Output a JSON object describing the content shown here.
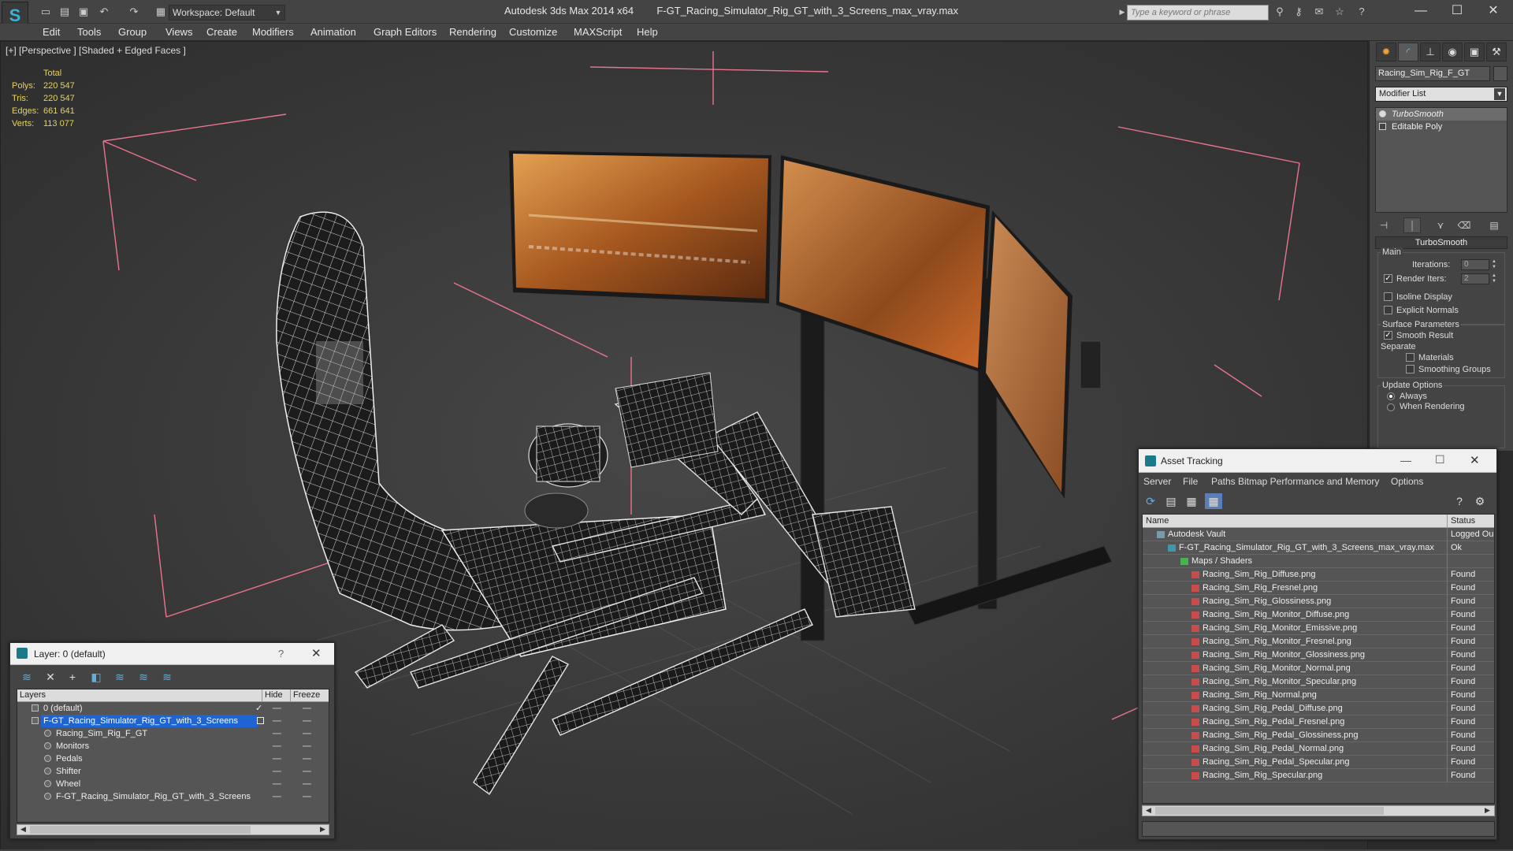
{
  "window": {
    "app_name": "Autodesk 3ds Max  2014 x64",
    "file_name": "F-GT_Racing_Simulator_Rig_GT_with_3_Screens_max_vray.max",
    "workspace": "Workspace: Default",
    "search_placeholder": "Type a keyword or phrase"
  },
  "menu": [
    "Edit",
    "Tools",
    "Group",
    "Views",
    "Create",
    "Modifiers",
    "Animation",
    "Graph Editors",
    "Rendering",
    "Customize",
    "MAXScript",
    "Help"
  ],
  "viewport": {
    "label": "[+] [Perspective ] [Shaded + Edged Faces ]",
    "stats": {
      "header": "Total",
      "rows": [
        {
          "label": "Polys:",
          "value": "220 547"
        },
        {
          "label": "Tris:",
          "value": "220 547"
        },
        {
          "label": "Edges:",
          "value": "661 641"
        },
        {
          "label": "Verts:",
          "value": "113 077"
        }
      ]
    }
  },
  "command_panel": {
    "object_name": "Racing_Sim_Rig_F_GT",
    "modifier_list": "Modifier List",
    "stack": [
      "TurboSmooth",
      "Editable Poly"
    ],
    "rollout_title": "TurboSmooth",
    "main_group": "Main",
    "iterations_label": "Iterations:",
    "iterations_value": "0",
    "render_iters_label": "Render Iters:",
    "render_iters_value": "2",
    "isoline": "Isoline Display",
    "explicit_normals": "Explicit Normals",
    "surface_group": "Surface Parameters",
    "smooth_result": "Smooth Result",
    "separate": "Separate",
    "materials": "Materials",
    "smoothing_groups": "Smoothing Groups",
    "update_group": "Update Options",
    "always": "Always",
    "when_rendering": "When Rendering"
  },
  "layer_explorer": {
    "title": "Layer: 0 (default)",
    "help": "?",
    "columns": [
      "Layers",
      "Hide",
      "Freeze"
    ],
    "rows": [
      {
        "name": "0 (default)",
        "indent": 0
      },
      {
        "name": "F-GT_Racing_Simulator_Rig_GT_with_3_Screens",
        "indent": 0,
        "selected": true
      },
      {
        "name": "Racing_Sim_Rig_F_GT",
        "indent": 1
      },
      {
        "name": "Monitors",
        "indent": 1
      },
      {
        "name": "Pedals",
        "indent": 1
      },
      {
        "name": "Shifter",
        "indent": 1
      },
      {
        "name": "Wheel",
        "indent": 1
      },
      {
        "name": "F-GT_Racing_Simulator_Rig_GT_with_3_Screens",
        "indent": 1
      }
    ]
  },
  "asset_tracking": {
    "title": "Asset Tracking",
    "menu": [
      "Server",
      "File",
      "Paths",
      "Bitmap Performance and Memory",
      "Options"
    ],
    "columns": [
      "Name",
      "Status"
    ],
    "rows": [
      {
        "name": "Autodesk Vault",
        "status": "Logged Ou",
        "level": 0
      },
      {
        "name": "F-GT_Racing_Simulator_Rig_GT_with_3_Screens_max_vray.max",
        "status": "Ok",
        "level": 1
      },
      {
        "name": "Maps / Shaders",
        "status": "",
        "level": 2
      },
      {
        "name": "Racing_Sim_Rig_Diffuse.png",
        "status": "Found",
        "level": 3
      },
      {
        "name": "Racing_Sim_Rig_Fresnel.png",
        "status": "Found",
        "level": 3
      },
      {
        "name": "Racing_Sim_Rig_Glossiness.png",
        "status": "Found",
        "level": 3
      },
      {
        "name": "Racing_Sim_Rig_Monitor_Diffuse.png",
        "status": "Found",
        "level": 3
      },
      {
        "name": "Racing_Sim_Rig_Monitor_Emissive.png",
        "status": "Found",
        "level": 3
      },
      {
        "name": "Racing_Sim_Rig_Monitor_Fresnel.png",
        "status": "Found",
        "level": 3
      },
      {
        "name": "Racing_Sim_Rig_Monitor_Glossiness.png",
        "status": "Found",
        "level": 3
      },
      {
        "name": "Racing_Sim_Rig_Monitor_Normal.png",
        "status": "Found",
        "level": 3
      },
      {
        "name": "Racing_Sim_Rig_Monitor_Specular.png",
        "status": "Found",
        "level": 3
      },
      {
        "name": "Racing_Sim_Rig_Normal.png",
        "status": "Found",
        "level": 3
      },
      {
        "name": "Racing_Sim_Rig_Pedal_Diffuse.png",
        "status": "Found",
        "level": 3
      },
      {
        "name": "Racing_Sim_Rig_Pedal_Fresnel.png",
        "status": "Found",
        "level": 3
      },
      {
        "name": "Racing_Sim_Rig_Pedal_Glossiness.png",
        "status": "Found",
        "level": 3
      },
      {
        "name": "Racing_Sim_Rig_Pedal_Normal.png",
        "status": "Found",
        "level": 3
      },
      {
        "name": "Racing_Sim_Rig_Pedal_Specular.png",
        "status": "Found",
        "level": 3
      },
      {
        "name": "Racing_Sim_Rig_Specular.png",
        "status": "Found",
        "level": 3
      }
    ]
  },
  "colors": {
    "selection_blue": "#1e64d2",
    "stats_yellow": "#e6d25c",
    "bounding_box_pink": "#e8748e"
  }
}
